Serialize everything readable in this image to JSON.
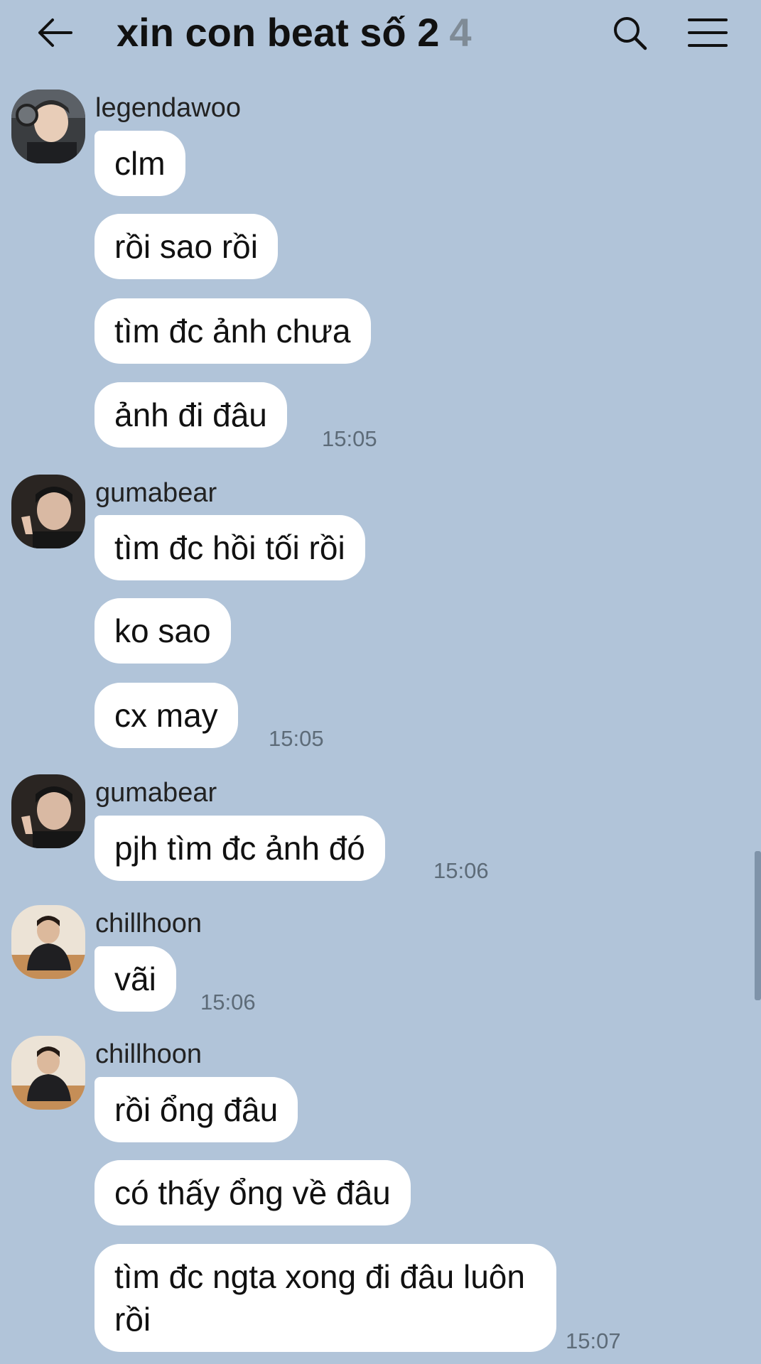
{
  "header": {
    "title": "xin con beat số 2",
    "member_count": "4",
    "icons": {
      "back": "arrow-left-icon",
      "search": "search-icon",
      "menu": "menu-icon"
    }
  },
  "messages": [
    {
      "sender": "legendawoo",
      "avatar": "avatar-legendawoo",
      "bubbles": [
        "clm",
        "rồi sao rồi",
        "tìm đc ảnh chưa",
        "ảnh đi đâu"
      ],
      "time": "15:05"
    },
    {
      "sender": "gumabear",
      "avatar": "avatar-gumabear",
      "bubbles": [
        "tìm đc hồi tối rồi",
        "ko sao",
        "cx may"
      ],
      "time": "15:05"
    },
    {
      "sender": "gumabear",
      "avatar": "avatar-gumabear",
      "bubbles": [
        "pjh tìm đc ảnh đó"
      ],
      "time": "15:06"
    },
    {
      "sender": "chillhoon",
      "avatar": "avatar-chillhoon",
      "bubbles": [
        "vãi"
      ],
      "time": "15:06"
    },
    {
      "sender": "chillhoon",
      "avatar": "avatar-chillhoon",
      "bubbles": [
        "rồi ổng đâu",
        "có thấy ổng về đâu",
        "tìm đc ngta xong đi đâu luôn rồi"
      ],
      "time": "15:07"
    }
  ],
  "colors": {
    "background": "#b1c4d9",
    "bubble": "#ffffff",
    "time_text": "#5d6b78",
    "count_text": "#7f8b96"
  }
}
